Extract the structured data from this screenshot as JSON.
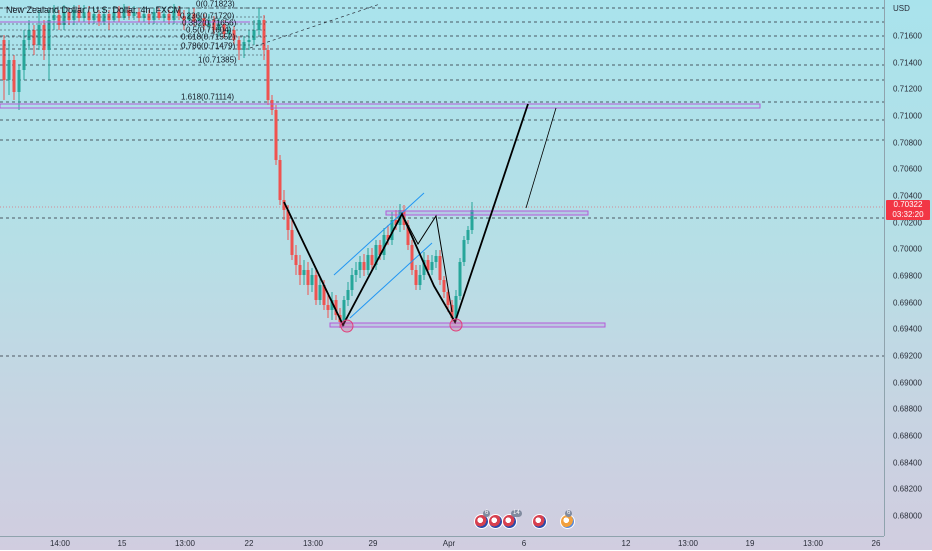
{
  "symbol_title": "New Zealand Dollar / U.S. Dollar, 4h, FXCM",
  "price_axis": {
    "currency": "USD",
    "ticks": [
      "0.71600",
      "0.71400",
      "0.71200",
      "0.71000",
      "0.70800",
      "0.70600",
      "0.70400",
      "0.70200",
      "0.70000",
      "0.69800",
      "0.69600",
      "0.69400",
      "0.69200",
      "0.69000",
      "0.68800",
      "0.68600",
      "0.68400",
      "0.68200",
      "0.68000"
    ]
  },
  "time_axis": {
    "ticks": [
      "14:00",
      "15",
      "13:00",
      "22",
      "13:00",
      "29",
      "Apr",
      "6",
      "12",
      "13:00",
      "19",
      "13:00",
      "26"
    ]
  },
  "current_price": {
    "value": "0.70322",
    "countdown": "03:32:20"
  },
  "fib_levels": [
    {
      "ratio": "0",
      "price": "0.71823"
    },
    {
      "ratio": "0.236",
      "price": "0.71720"
    },
    {
      "ratio": "0.382",
      "price": "0.71656"
    },
    {
      "ratio": "0.5",
      "price": "0.71604"
    },
    {
      "ratio": "0.618",
      "price": "0.71552"
    },
    {
      "ratio": "0.786",
      "price": "0.71479"
    },
    {
      "ratio": "1",
      "price": "0.71385"
    },
    {
      "ratio": "1.618",
      "price": "0.71114"
    }
  ],
  "event_badges": [
    "6",
    "14",
    "6"
  ],
  "colors": {
    "bull_candle": "#26a69a",
    "bear_candle": "#ef5350",
    "zone_border": "#b45ad8",
    "pattern_line": "#000000",
    "channel_line": "#2196f3",
    "price_badge": "#f23645",
    "marker_circle": "#e0407a"
  },
  "icons": [
    "us-flag-event-icon",
    "nz-flag-event-icon",
    "us-flag-event-icon",
    "us-flag-event-icon",
    "nz-flag-event-icon"
  ]
}
